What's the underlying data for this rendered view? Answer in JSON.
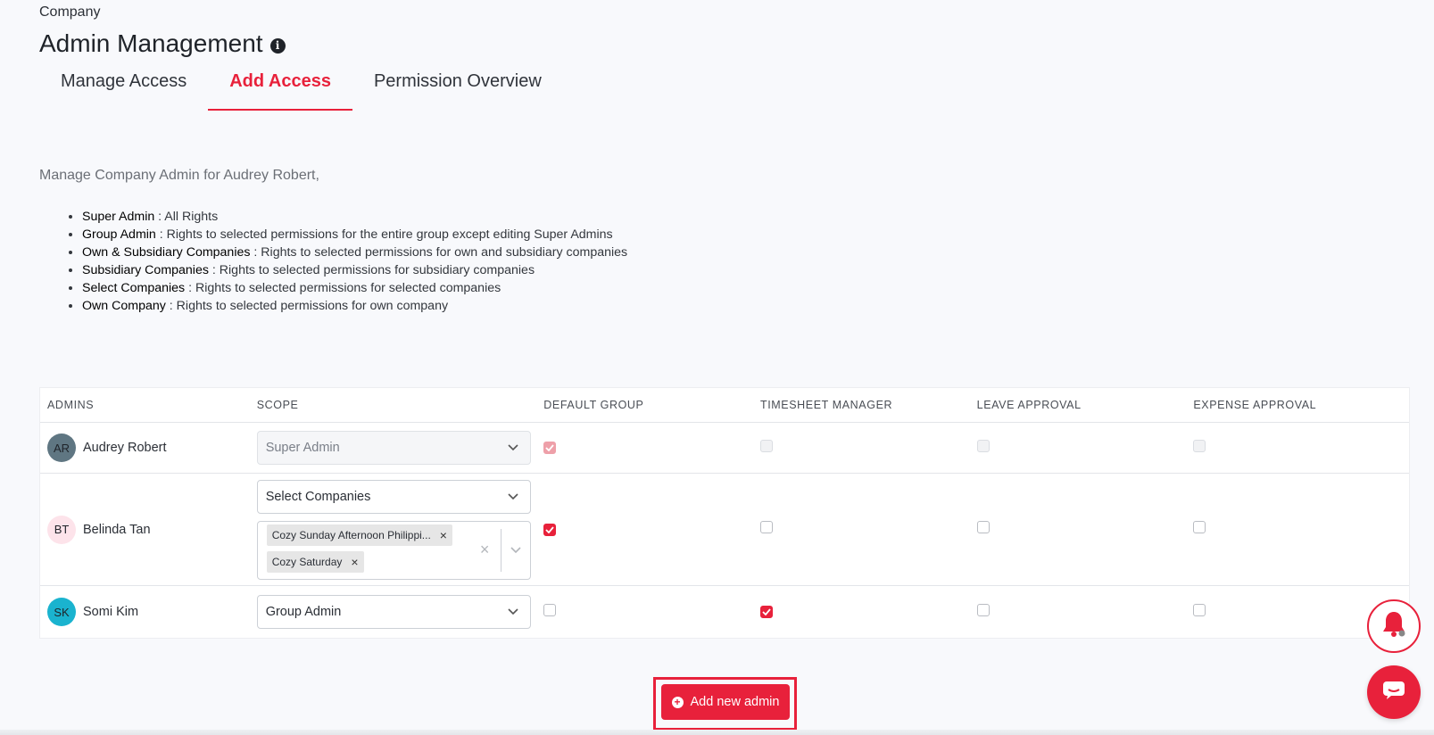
{
  "breadcrumb": "Company",
  "page_title": "Admin Management",
  "info_glyph": "i",
  "tabs": [
    {
      "label": "Manage Access",
      "active": false
    },
    {
      "label": "Add Access",
      "active": true
    },
    {
      "label": "Permission Overview",
      "active": false
    }
  ],
  "intro": "Manage Company Admin for Audrey Robert,",
  "legend": [
    {
      "term": "Super Admin",
      "desc": " : All Rights"
    },
    {
      "term": "Group Admin",
      "desc": " : Rights to selected permissions for the entire group except editing Super Admins"
    },
    {
      "term": "Own & Subsidiary Companies",
      "desc": " : Rights to selected permissions for own and subsidiary companies"
    },
    {
      "term": "Subsidiary Companies",
      "desc": " : Rights to selected permissions for subsidiary companies"
    },
    {
      "term": "Select Companies",
      "desc": " : Rights to selected permissions for selected companies"
    },
    {
      "term": "Own Company",
      "desc": " : Rights to selected permissions for own company"
    }
  ],
  "table": {
    "headers": [
      "ADMINS",
      "SCOPE",
      "DEFAULT GROUP",
      "TIMESHEET MANAGER",
      "LEAVE APPROVAL",
      "EXPENSE APPROVAL"
    ],
    "rows": [
      {
        "initials": "AR",
        "name": "Audrey Robert",
        "avatar_color": "#5f7682",
        "scope": "Super Admin",
        "scope_disabled": true,
        "default_group": "checked-disabled",
        "timesheet_manager": "disabled",
        "leave_approval": "disabled",
        "expense_approval": "disabled"
      },
      {
        "initials": "BT",
        "name": "Belinda Tan",
        "avatar_color": "#fde3ea",
        "scope": "Select Companies",
        "scope_disabled": false,
        "companies": [
          "Cozy Sunday Afternoon Philippi...",
          "Cozy Saturday"
        ],
        "tag_remove": "×",
        "clear_all": "×",
        "default_group": "checked",
        "timesheet_manager": "unchecked",
        "leave_approval": "unchecked",
        "expense_approval": "unchecked"
      },
      {
        "initials": "SK",
        "name": "Somi Kim",
        "avatar_color": "#1ab3cf",
        "scope": "Group Admin",
        "scope_disabled": false,
        "default_group": "unchecked",
        "timesheet_manager": "checked",
        "leave_approval": "unchecked",
        "expense_approval": "unchecked"
      }
    ]
  },
  "add_button": {
    "label": "Add new admin",
    "plus": "+"
  },
  "colors": {
    "accent": "#e8213b"
  },
  "icons": {
    "bell": "bell-icon",
    "chat": "chat-icon",
    "chevron": "chevron-down-icon",
    "check": "check-icon"
  }
}
